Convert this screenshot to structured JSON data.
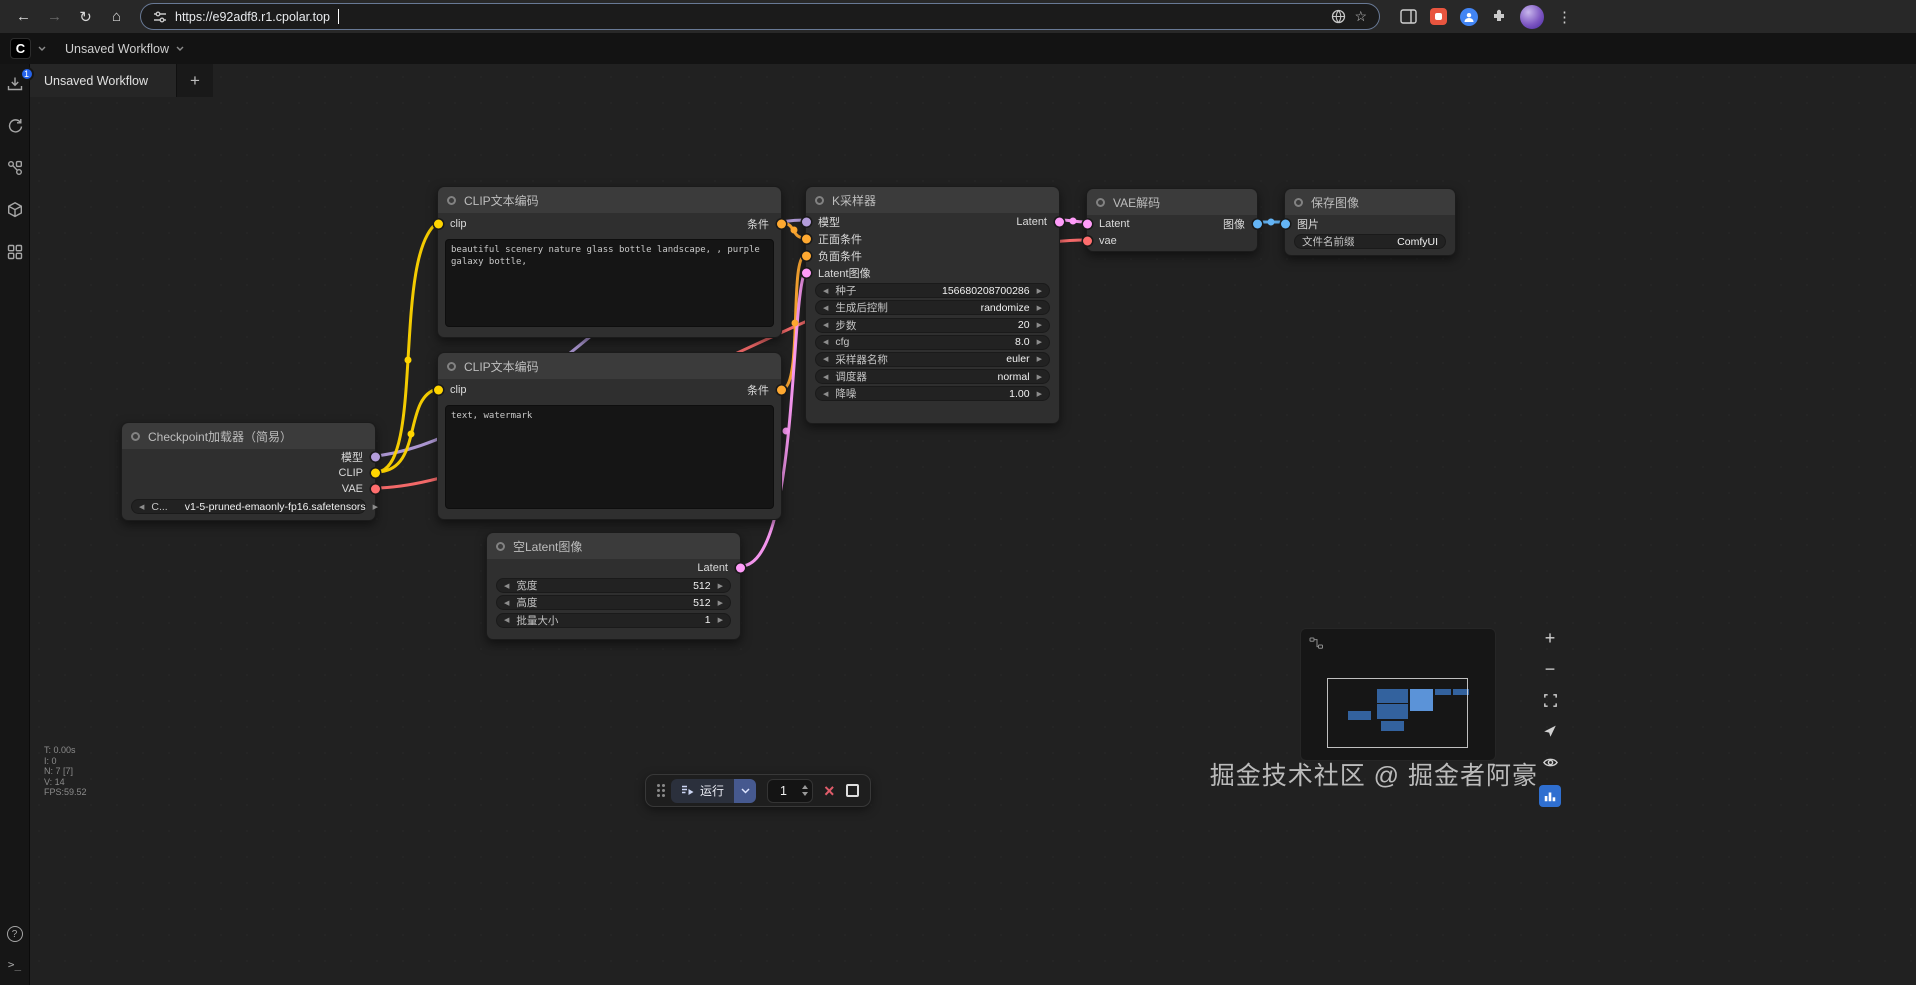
{
  "browser": {
    "url": "https://e92adf8.r1.cpolar.top"
  },
  "menubar": {
    "workflow_name": "Unsaved Workflow"
  },
  "tabbar": {
    "active_tab": "Unsaved Workflow",
    "queue_badge": "1"
  },
  "nodes": {
    "clip_pos": {
      "title": "CLIP文本编码",
      "input": "clip",
      "output": "条件",
      "text": "beautiful scenery nature glass bottle landscape, , purple galaxy bottle,"
    },
    "clip_neg": {
      "title": "CLIP文本编码",
      "input": "clip",
      "output": "条件",
      "text": "text, watermark"
    },
    "checkpoint": {
      "title": "Checkpoint加载器（简易）",
      "outputs": [
        "模型",
        "CLIP",
        "VAE"
      ],
      "widget": {
        "name": "C...",
        "value": "v1-5-pruned-emaonly-fp16.safetensors"
      }
    },
    "ksampler": {
      "title": "K采样器",
      "inputs": [
        "模型",
        "正面条件",
        "负面条件",
        "Latent图像"
      ],
      "output": "Latent",
      "widgets": [
        {
          "name": "种子",
          "value": "156680208700286"
        },
        {
          "name": "生成后控制",
          "value": "randomize"
        },
        {
          "name": "步数",
          "value": "20"
        },
        {
          "name": "cfg",
          "value": "8.0"
        },
        {
          "name": "采样器名称",
          "value": "euler"
        },
        {
          "name": "调度器",
          "value": "normal"
        },
        {
          "name": "降噪",
          "value": "1.00"
        }
      ]
    },
    "empty_latent": {
      "title": "空Latent图像",
      "output": "Latent",
      "widgets": [
        {
          "name": "宽度",
          "value": "512"
        },
        {
          "name": "高度",
          "value": "512"
        },
        {
          "name": "批量大小",
          "value": "1"
        }
      ]
    },
    "vae_decode": {
      "title": "VAE解码",
      "inputs": [
        "Latent",
        "vae"
      ],
      "output": "图像"
    },
    "save_image": {
      "title": "保存图像",
      "input": "图片",
      "widget": {
        "name": "文件名前缀",
        "value": "ComfyUI"
      }
    }
  },
  "runbar": {
    "run_label": "运行",
    "batch_count": "1"
  },
  "stats": {
    "lines": [
      "T: 0.00s",
      "I: 0",
      "N: 7 [7]",
      "V: 14",
      "FPS:59.52"
    ]
  },
  "watermark": "掘金技术社区 @ 掘金者阿豪",
  "colors": {
    "model": "#b39ddb",
    "clip": "#ffd500",
    "vae": "#ff6e6e",
    "conditioning": "#ffa931",
    "latent": "#ff9cf9",
    "image": "#64b5f6"
  }
}
